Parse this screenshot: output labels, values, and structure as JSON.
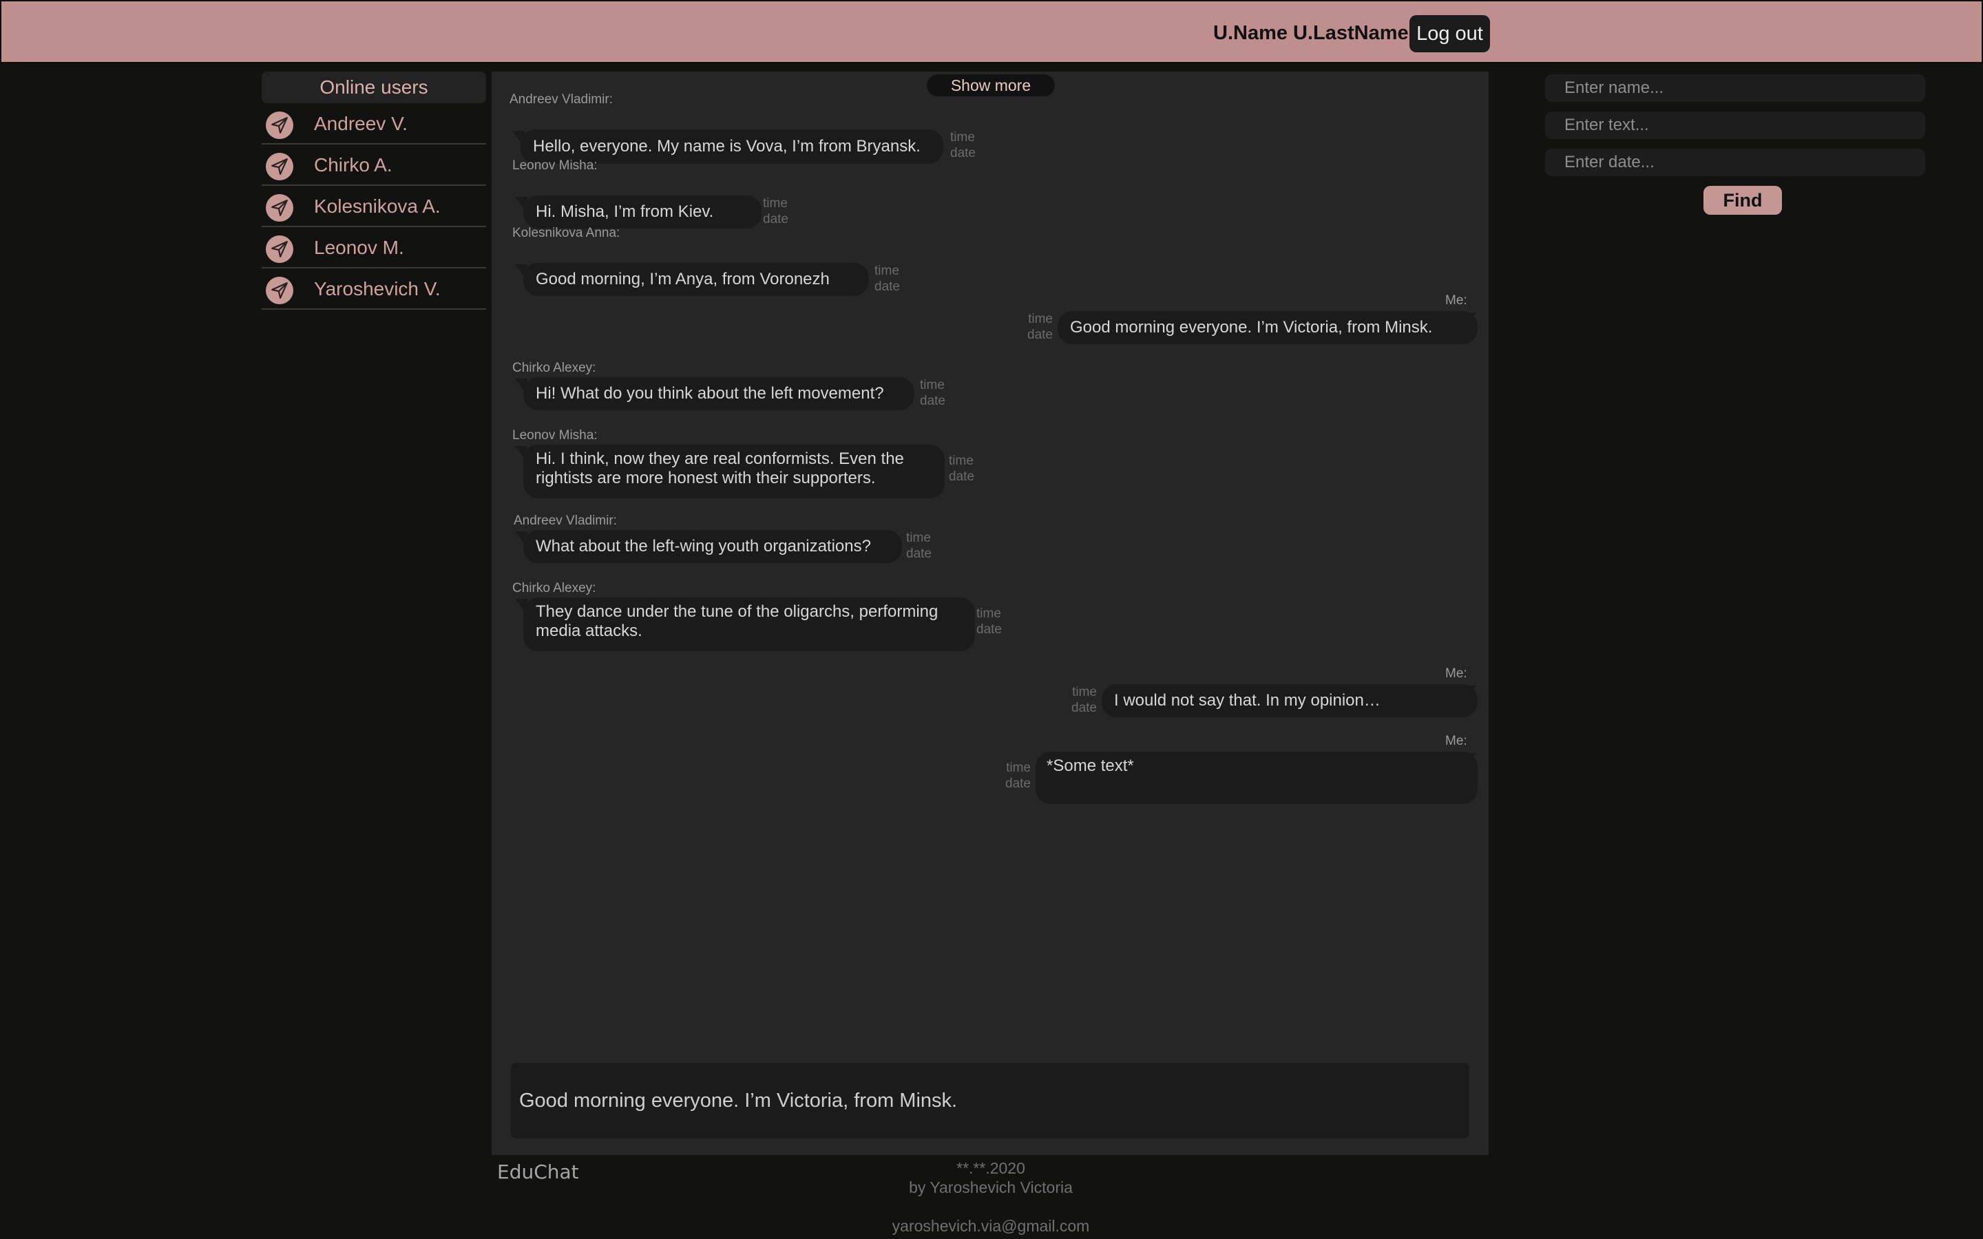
{
  "header": {
    "user_name": "U.Name U.LastName",
    "logout_label": "Log out",
    "accent_color": "#bf8e8e"
  },
  "sidebar": {
    "title": "Online users",
    "users": [
      {
        "label": "Andreev V.",
        "icon": "send-icon"
      },
      {
        "label": "Chirko A.",
        "icon": "send-icon"
      },
      {
        "label": "Kolesnikova A.",
        "icon": "send-icon"
      },
      {
        "label": "Leonov M.",
        "icon": "send-icon"
      },
      {
        "label": "Yaroshevich V.",
        "icon": "send-icon"
      }
    ]
  },
  "chat": {
    "show_more_label": "Show more",
    "time_label": "time",
    "date_label": "date",
    "messages": [
      {
        "author": "Andreev Vladimir:",
        "text": "Hello, everyone. My name is Vova, I’m from Bryansk.",
        "own": false
      },
      {
        "author": "Leonov Misha:",
        "text": "Hi. Misha, I’m from Kiev.",
        "own": false
      },
      {
        "author": "Kolesnikova Anna:",
        "text": "Good morning, I’m Anya, from Voronezh",
        "own": false
      },
      {
        "author": "Me:",
        "text": "Good morning everyone. I’m Victoria, from Minsk.",
        "own": true
      },
      {
        "author": "Chirko Alexey:",
        "text": "Hi! What do you think about the left movement?",
        "own": false
      },
      {
        "author": "Leonov Misha:",
        "text": "Hi. I think, now they are real conformists. Even the rightists are more honest with their supporters.",
        "own": false
      },
      {
        "author": "Andreev Vladimir:",
        "text": "What about the left-wing youth organizations?",
        "own": false
      },
      {
        "author": "Chirko Alexey:",
        "text": "They dance under the tune of the oligarchs, performing media attacks.",
        "own": false
      },
      {
        "author": "Me:",
        "text": "I would not say that. In my opinion…",
        "own": true
      },
      {
        "author": "Me:",
        "text": "*Some text*",
        "own": true
      }
    ],
    "composer_value": "Good morning everyone. I’m Victoria, from Minsk."
  },
  "search": {
    "name_placeholder": "Enter name...",
    "text_placeholder": "Enter text...",
    "date_placeholder": "Enter date...",
    "find_label": "Find"
  },
  "footer": {
    "brand": "EduChat",
    "date": "**.**.2020",
    "author": "by Yaroshevich Victoria",
    "email": "yaroshevich.via@gmail.com"
  }
}
